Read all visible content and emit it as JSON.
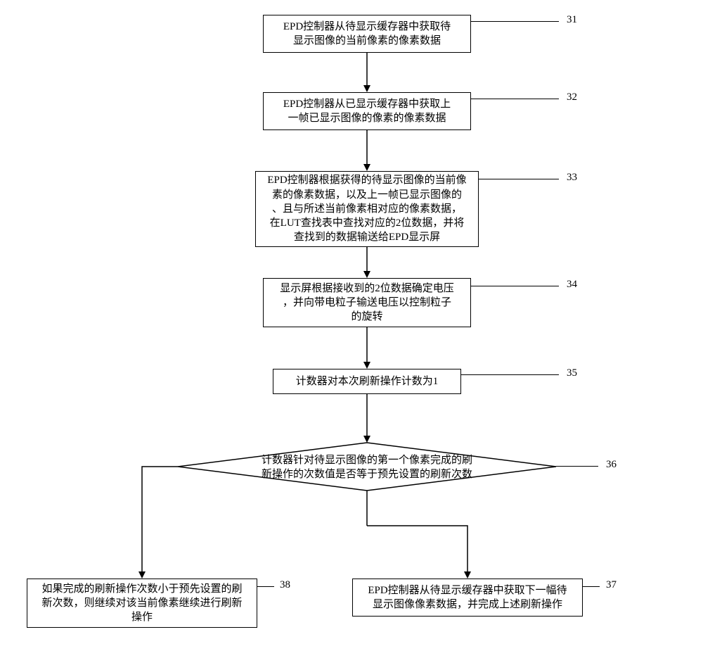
{
  "steps": {
    "s31": {
      "num": "31",
      "text": "EPD控制器从待显示缓存器中获取待\n显示图像的当前像素的像素数据"
    },
    "s32": {
      "num": "32",
      "text": "EPD控制器从已显示缓存器中获取上\n一帧已显示图像的像素的像素数据"
    },
    "s33": {
      "num": "33",
      "text": "EPD控制器根据获得的待显示图像的当前像\n素的像素数据，以及上一帧已显示图像的\n、且与所述当前像素相对应的像素数据，\n在LUT查找表中查找对应的2位数据，并将\n查找到的数据输送给EPD显示屏"
    },
    "s34": {
      "num": "34",
      "text": "显示屏根据接收到的2位数据确定电压\n，并向带电粒子输送电压以控制粒子\n的旋转"
    },
    "s35": {
      "num": "35",
      "text": "计数器对本次刷新操作计数为1"
    },
    "s36": {
      "num": "36",
      "text": "计数器针对待显示图像的第一个像素完成的刷\n新操作的次数值是否等于预先设置的刷新次数"
    },
    "s37": {
      "num": "37",
      "text": "EPD控制器从待显示缓存器中获取下一幅待\n显示图像像素数据，并完成上述刷新操作"
    },
    "s38": {
      "num": "38",
      "text": "如果完成的刷新操作次数小于预先设置的刷\n新次数，则继续对该当前像素继续进行刷新\n操作"
    }
  }
}
